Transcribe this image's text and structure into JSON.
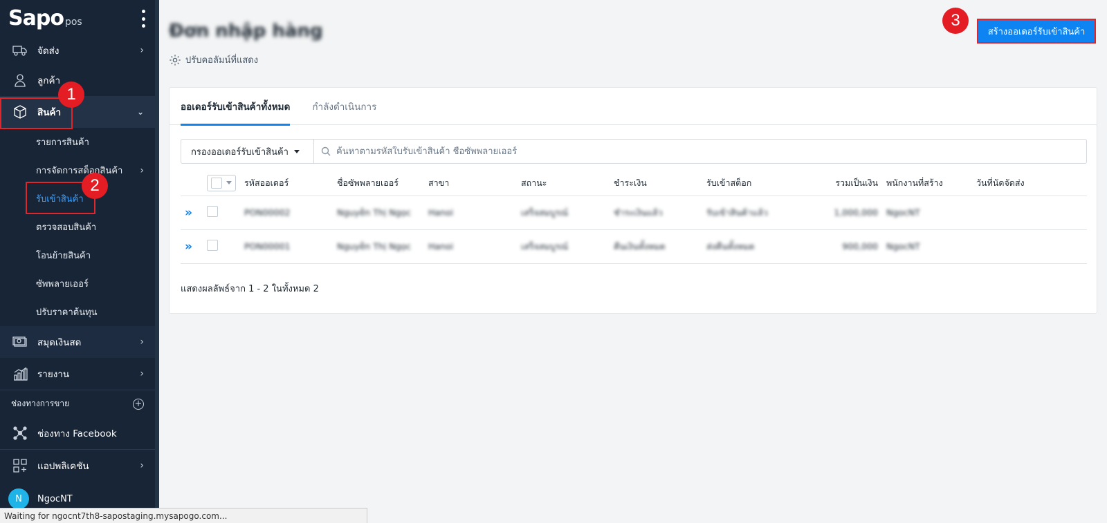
{
  "sidebar": {
    "logo": "Sapo",
    "logo_suffix": "pos",
    "items": {
      "shipping": "จัดส่ง",
      "customers": "ลูกค้า",
      "products": "สินค้า",
      "cashbook": "สมุดเงินสด",
      "reports": "รายงาน",
      "facebook": "ช่องทาง Facebook",
      "apps": "แอปพลิเคชัน"
    },
    "sub_items": [
      "รายการสินค้า",
      "การจัดการสต็อกสินค้า",
      "รับเข้าสินค้า",
      "ตรวจสอบสินค้า",
      "โอนย้ายสินค้า",
      "ซัพพลายเออร์",
      "ปรับราคาต้นทุน"
    ],
    "sales_channels_label": "ช่องทางการขาย",
    "user": {
      "initial": "N",
      "name": "NgocNT"
    }
  },
  "page": {
    "title": "Đơn nhập hàng",
    "column_settings": "ปรับคอลัมน์ที่แสดง",
    "create_button": "สร้างออเดอร์รับเข้าสินค้า"
  },
  "tabs": [
    "ออเดอร์รับเข้าสินค้าทั้งหมด",
    "กำลังดำเนินการ"
  ],
  "filter": {
    "dropdown": "กรองออเดอร์รับเข้าสินค้า",
    "search_placeholder": "ค้นหาตามรหัสใบรับเข้าสินค้า ชื่อซัพพลายเออร์"
  },
  "table": {
    "headers": [
      "รหัสออเดอร์",
      "ชื่อซัพพลายเออร์",
      "สาขา",
      "สถานะ",
      "ชำระเงิน",
      "รับเข้าสต็อก",
      "รวมเป็นเงิน",
      "พนักงานที่สร้าง",
      "วันที่นัดจัดส่ง"
    ],
    "rows": [
      {
        "code": "PON00002",
        "supplier": "Nguyễn Thị Ngọc",
        "branch": "Hanoi",
        "status": "เสร็จสมบูรณ์",
        "payment": "ชำระเงินแล้ว",
        "stock": "รับเข้าสินค้าแล้ว",
        "total": "1,000,000",
        "staff": "NgocNT",
        "date": ""
      },
      {
        "code": "PON00001",
        "supplier": "Nguyễn Thị Ngọc",
        "branch": "Hanoi",
        "status": "เสร็จสมบูรณ์",
        "payment": "คืนเงินทั้งหมด",
        "stock": "ส่งคืนทั้งหมด",
        "total": "900,000",
        "staff": "NgocNT",
        "date": ""
      }
    ]
  },
  "results_text": "แสดงผลลัพธ์จาก 1 - 2 ในทั้งหมด 2",
  "annotations": [
    "1",
    "2",
    "3"
  ],
  "status_bar": "Waiting for ngocnt7th8-sapostaging.mysapogo.com...",
  "colors": {
    "sidebar": "#182537",
    "accent": "#0d84f2",
    "annotation": "#e41d25",
    "status_green": "#1ea54a"
  }
}
